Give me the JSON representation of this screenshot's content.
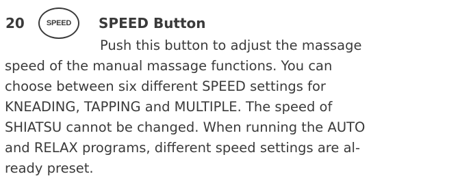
{
  "section": {
    "number": "20",
    "icon_label": "SPEED",
    "title": "SPEED Button"
  },
  "body": {
    "lines": [
      "Push this button to adjust the massage",
      "speed of the manual massage functions. You can",
      "choose between six different SPEED settings for",
      "KNEADING, TAPPING and MULTIPLE. The speed of",
      "SHIATSU cannot be changed. When running the AUTO",
      "and RELAX programs, different speed settings are al-",
      "ready preset."
    ]
  }
}
